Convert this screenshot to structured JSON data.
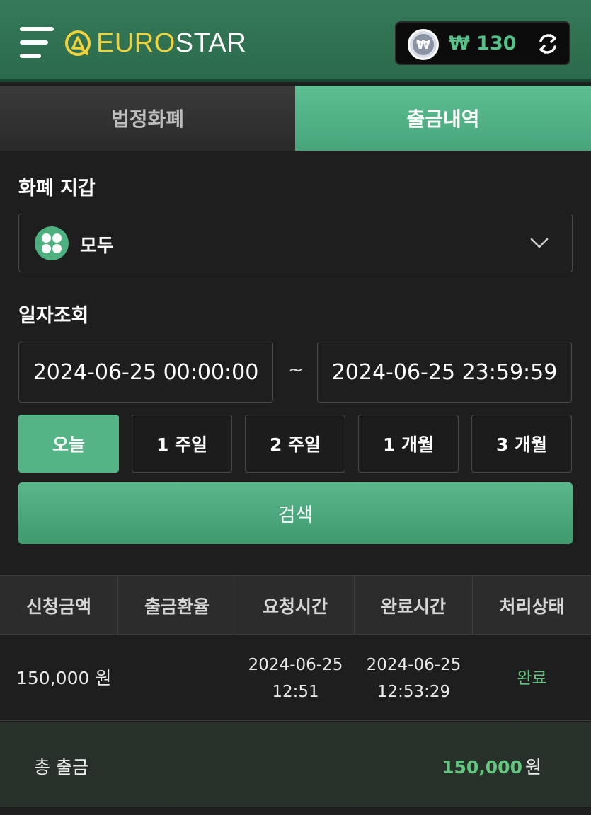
{
  "header": {
    "logo_euro": "EURO",
    "logo_star": "STAR",
    "currency_symbol": "₩",
    "balance": "₩ 130"
  },
  "tabs": [
    {
      "label": "법정화폐",
      "active": false
    },
    {
      "label": "출금내역",
      "active": true
    }
  ],
  "wallet": {
    "label": "화폐 지갑",
    "selected": "모두"
  },
  "date_search": {
    "label": "일자조회",
    "start": "2024-06-25 00:00:00",
    "separator": "~",
    "end": "2024-06-25 23:59:59"
  },
  "quick_ranges": [
    "오늘",
    "1 주일",
    "2 주일",
    "1 개월",
    "3 개월"
  ],
  "search_button": "검색",
  "table": {
    "columns": [
      "신청금액",
      "출금환율",
      "요청시간",
      "완료시간",
      "처리상태"
    ],
    "rows": [
      {
        "amount": "150,000 원",
        "rate": "",
        "request_date": "2024-06-25",
        "request_time": "12:51",
        "complete_date": "2024-06-25",
        "complete_time": "12:53:29",
        "status": "완료"
      }
    ]
  },
  "total": {
    "label": "총 출금",
    "value": "150,000",
    "unit": "원"
  },
  "colors": {
    "accent": "#54b486",
    "header_bg": "#2f7050",
    "logo_yellow": "#f0d23c",
    "status_done": "#62c47e"
  }
}
